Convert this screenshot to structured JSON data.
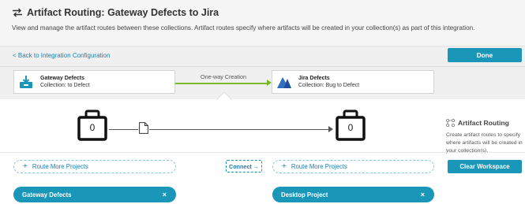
{
  "header": {
    "title": "Artifact Routing: Gateway Defects to Jira",
    "subtitle": "View and manage the artifact routes between these collections. Artifact routes specify where artifacts will be created in your collection(s) as part of this integration."
  },
  "toolbar": {
    "back_label": "< Back to Integration Configuration",
    "done_label": "Done"
  },
  "source": {
    "name": "Gateway Defects",
    "collection": "Collection: to Defect",
    "count": "0"
  },
  "target": {
    "name": "Jira Defects",
    "collection": "Collection: Bug to Defect",
    "count": "0"
  },
  "connection": {
    "label": "One-way Creation"
  },
  "side_panel": {
    "title": "Artifact Routing",
    "description": "Create artifact routes to specify where artifacts will be created in your collection(s)."
  },
  "actions": {
    "route_more_left": "Route More Projects",
    "route_more_right": "Route More Projects",
    "connect": "Connect",
    "connect_arrow": "→",
    "clear_workspace": "Clear Workspace"
  },
  "projects": {
    "left": "Gateway Defects",
    "right": "Desktop Project",
    "remove_glyph": "×"
  },
  "colors": {
    "accent": "#1a96b8",
    "link": "#1a7fb0",
    "route_line": "#7ab829"
  },
  "icons": [
    "swap-arrows-icon",
    "download-tray-icon",
    "jira-logo-icon",
    "briefcase-icon",
    "document-icon",
    "routing-icon",
    "plus-icon",
    "close-icon"
  ]
}
